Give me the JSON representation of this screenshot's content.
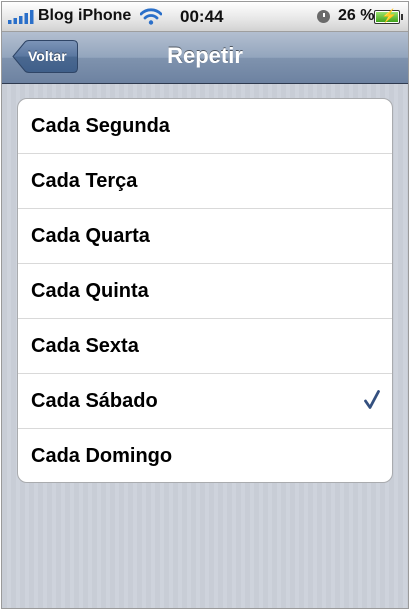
{
  "status_bar": {
    "carrier": "Blog iPhone",
    "time": "00:44",
    "battery": "26 %"
  },
  "nav": {
    "back_label": "Voltar",
    "title": "Repetir"
  },
  "options": [
    {
      "label": "Cada Segunda",
      "checked": false
    },
    {
      "label": "Cada Terça",
      "checked": false
    },
    {
      "label": "Cada Quarta",
      "checked": false
    },
    {
      "label": "Cada Quinta",
      "checked": false
    },
    {
      "label": "Cada Sexta",
      "checked": false
    },
    {
      "label": "Cada Sábado",
      "checked": true
    },
    {
      "label": "Cada Domingo",
      "checked": false
    }
  ],
  "icons": {
    "signal": "signal-bars-icon",
    "wifi": "wifi-icon",
    "alarm": "alarm-clock-icon",
    "battery": "battery-charging-icon",
    "checkmark": "checkmark-icon"
  },
  "colors": {
    "navbar": "#7f93ae",
    "checkmark": "#34507f",
    "background_stripes": "#c8cdd6",
    "battery_fill": "#3fa31b"
  }
}
